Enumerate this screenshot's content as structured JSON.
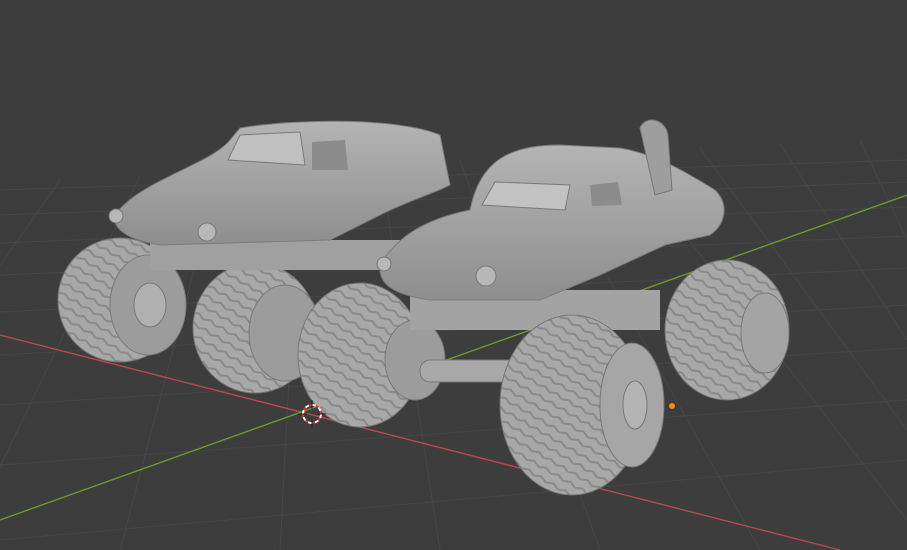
{
  "viewport": {
    "background": "#3d3d3d",
    "grid_color": "#4a4a4a",
    "axis_x_color": "#b8484f",
    "axis_y_color": "#6a9a2c",
    "mesh_color": "#a9a9a9"
  },
  "scene": {
    "objects": [
      "monster-truck-back",
      "monster-truck-front"
    ]
  },
  "cursor_3d": "3d-cursor-icon",
  "origin_marker": "object-origin-icon"
}
